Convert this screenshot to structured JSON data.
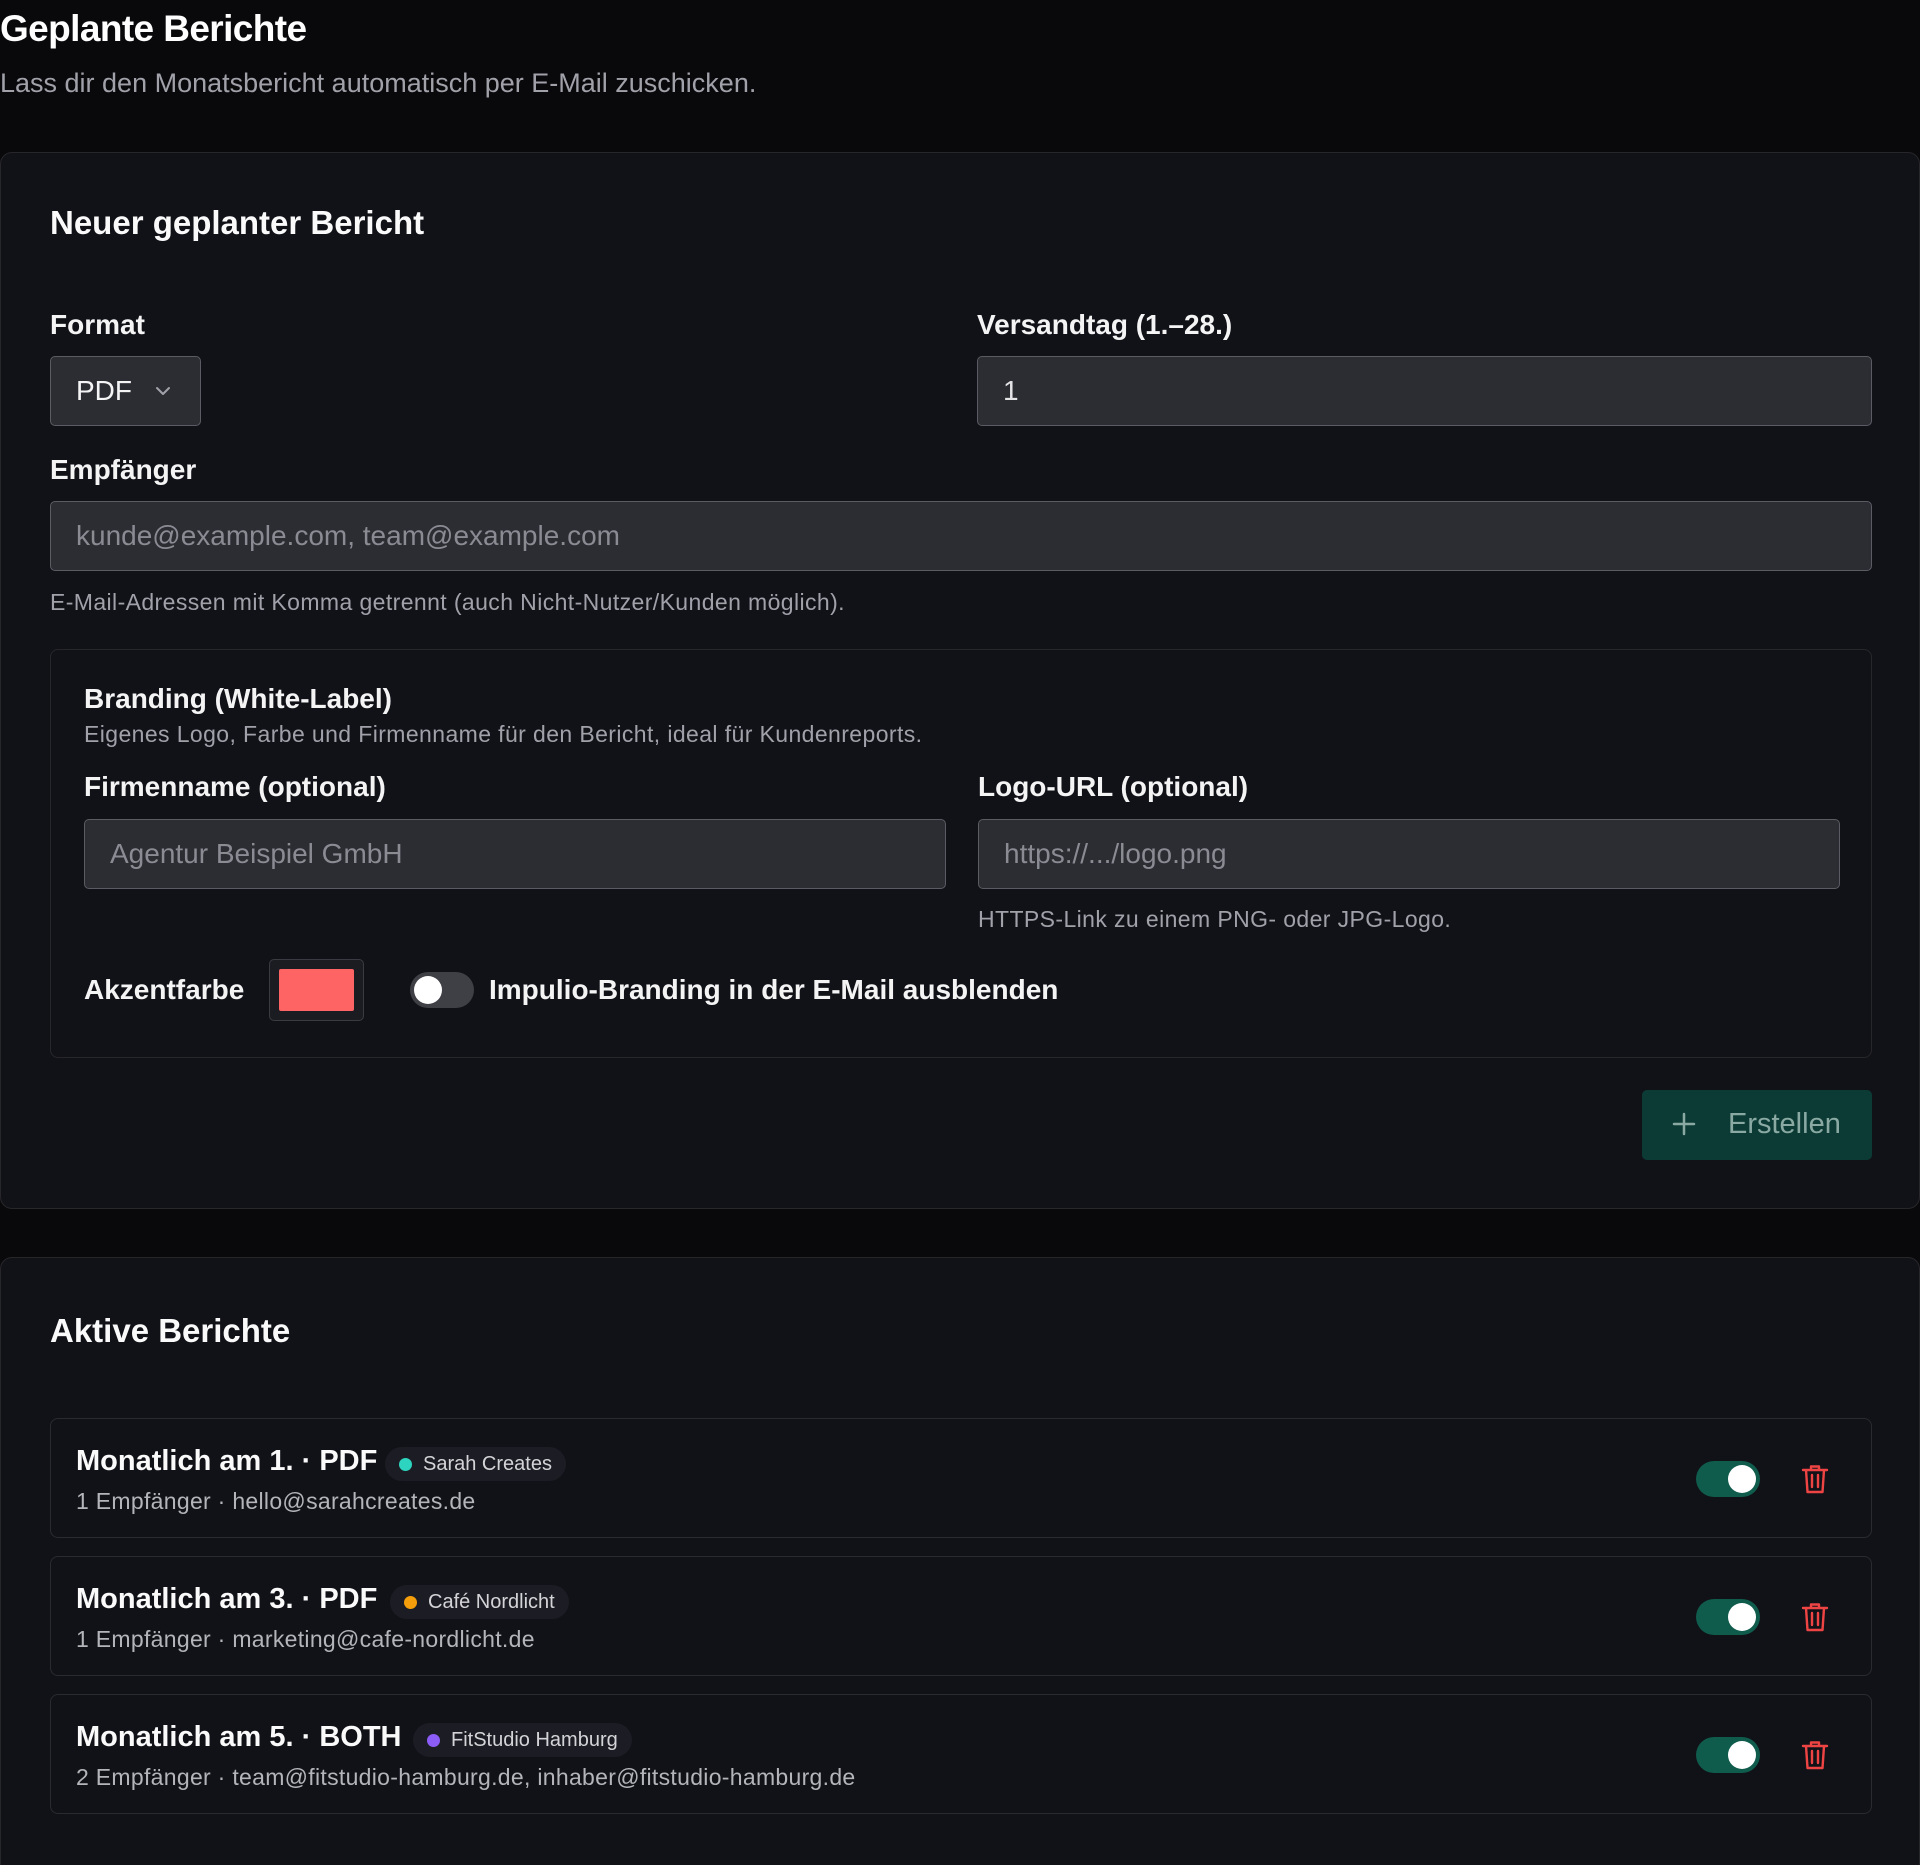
{
  "page": {
    "title": "Geplante Berichte",
    "subtitle": "Lass dir den Monatsbericht automatisch per E-Mail zuschicken."
  },
  "form": {
    "title": "Neuer geplanter Bericht",
    "format_label": "Format",
    "format_value": "PDF",
    "day_label": "Versandtag (1.–28.)",
    "day_value": "1",
    "recipients_label": "Empfänger",
    "recipients_placeholder": "kunde@example.com, team@example.com",
    "recipients_hint": "E-Mail-Adressen mit Komma getrennt (auch Nicht-Nutzer/Kunden möglich).",
    "branding": {
      "title": "Branding (White-Label)",
      "description": "Eigenes Logo, Farbe und Firmenname für den Bericht, ideal für Kundenreports.",
      "company_label": "Firmenname (optional)",
      "company_placeholder": "Agentur Beispiel GmbH",
      "logo_label": "Logo-URL (optional)",
      "logo_placeholder": "https://.../logo.png",
      "logo_hint": "HTTPS-Link zu einem PNG- oder JPG-Logo.",
      "accent_label": "Akzentfarbe",
      "accent_color": "#ff6464",
      "hide_branding_label": "Impulio-Branding in der E-Mail ausblenden",
      "hide_branding_enabled": false
    },
    "create_label": "Erstellen",
    "create_icon": "plus-icon"
  },
  "list": {
    "title": "Aktive Berichte",
    "items": [
      {
        "title": "Monatlich am 1. · PDF",
        "badge": "Sarah Creates",
        "badge_color": "#2dd4bf",
        "subtitle": "1 Empfänger · hello@sarahcreates.de",
        "enabled": true
      },
      {
        "title": "Monatlich am 3. · PDF",
        "badge": "Café Nordlicht",
        "badge_color": "#f59e0b",
        "subtitle": "1 Empfänger · marketing@cafe-nordlicht.de",
        "enabled": true
      },
      {
        "title": "Monatlich am 5. · BOTH",
        "badge": "FitStudio Hamburg",
        "badge_color": "#8b5cf6",
        "subtitle": "2 Empfänger · team@fitstudio-hamburg.de, inhaber@fitstudio-hamburg.de",
        "enabled": true
      }
    ]
  },
  "colors": {
    "background": "#09090c",
    "card": "#111218",
    "toggle_on": "#0f5c4c",
    "create_button": "#0c3b35",
    "delete_icon": "#ef4444"
  }
}
